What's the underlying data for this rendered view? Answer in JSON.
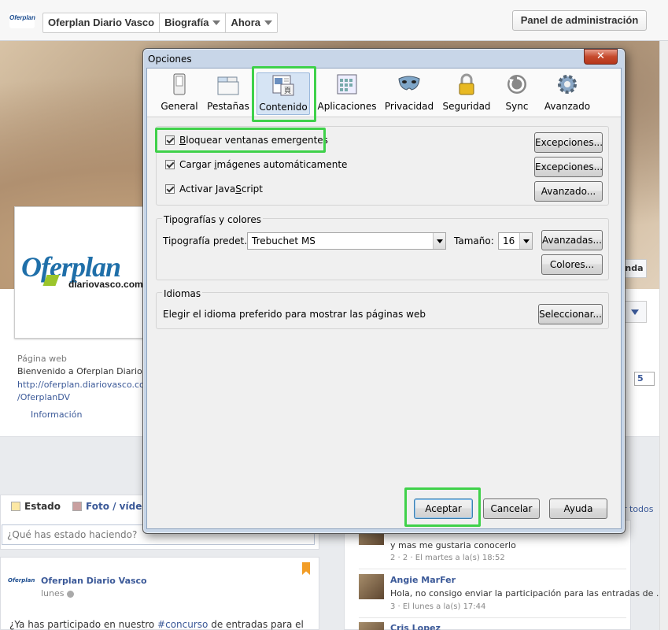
{
  "fb": {
    "logo": "Oferplan",
    "breadcrumbs": [
      "Oferplan Diario Vasco",
      "Biografía",
      "Ahora"
    ],
    "admin_button": "Panel de administración",
    "page_web_label": "Página web",
    "page_web_text": "Bienvenido a Oferplan Diario Vasco",
    "page_web_link": "http://oferplan.diariovasco.com/",
    "page_web_link2": "/OferplanDV",
    "info_link": "Información",
    "badge": "5",
    "right_button": "nda",
    "profile_brand": "Oferplan",
    "profile_domain": "diariovasco.com",
    "composer": {
      "tab_status": "Estado",
      "tab_photo": "Foto / vídeo",
      "placeholder": "¿Qué has estado haciendo?"
    },
    "post": {
      "author": "Oferplan Diario Vasco",
      "time": "lunes",
      "text_before": "¿Ya has participado en nuestro ",
      "hashtag": "#concurso",
      "text_after": " de entradas para el"
    },
    "see_all": "r todos",
    "comments": [
      {
        "name": "",
        "text": "y mas me gustaria conocerlo",
        "meta": "2 · 2 · El martes a la(s) 18:52"
      },
      {
        "name": "Angie MarFer",
        "text": "Hola, no consigo enviar la participación para las entradas de ...",
        "meta": "3 · El lunes a la(s) 17:44"
      },
      {
        "name": "Cris Lopez",
        "text": "",
        "meta": ""
      }
    ]
  },
  "dialog": {
    "title": "Opciones",
    "close": "✕",
    "tabs": [
      "General",
      "Pestañas",
      "Contenido",
      "Aplicaciones",
      "Privacidad",
      "Seguridad",
      "Sync",
      "Avanzado"
    ],
    "selected_tab": "Contenido",
    "popups": {
      "label_pre": "B",
      "label_post": "loquear ventanas emergentes",
      "checked": true,
      "button": "Excepciones..."
    },
    "images": {
      "label_pre": "Cargar ",
      "label_u": "i",
      "label_post": "mágenes automáticamente",
      "checked": true,
      "button": "Excepciones..."
    },
    "js": {
      "label_pre": "Activar Java",
      "label_u": "S",
      "label_post": "cript",
      "checked": true,
      "button": "Avanzado..."
    },
    "fonts": {
      "group": "Tipografías y colores",
      "default_label": "Tipografía predet.:",
      "default_font": "Trebuchet MS",
      "size_label": "Tamaño:",
      "size": "16",
      "advanced": "Avanzadas...",
      "colors": "Colores..."
    },
    "languages": {
      "group": "Idiomas",
      "text": "Elegir el idioma preferido para mostrar las páginas web",
      "button": "Seleccionar..."
    },
    "footer": {
      "ok": "Aceptar",
      "cancel": "Cancelar",
      "help": "Ayuda"
    }
  }
}
